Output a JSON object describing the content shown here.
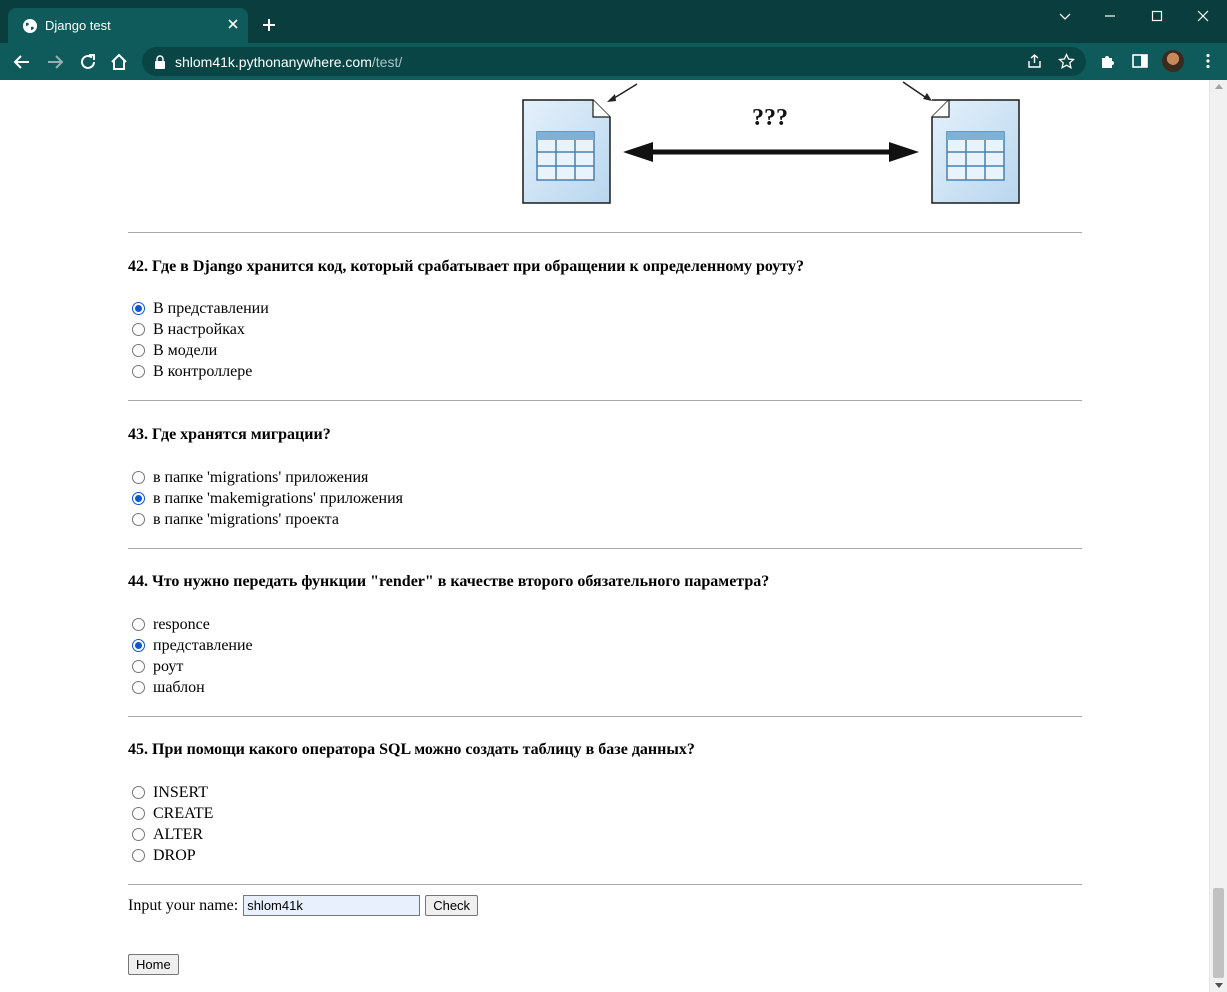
{
  "browser": {
    "tab_title": "Django test",
    "url_host": "shlom41k.pythonanywhere.com",
    "url_path": "/test/",
    "icons": [
      "globe-icon",
      "close-icon",
      "plus-icon",
      "chevron-down-icon",
      "minimize-icon",
      "maximize-icon",
      "close-window-icon",
      "back-icon",
      "forward-icon",
      "reload-icon",
      "home-icon",
      "lock-icon",
      "share-icon",
      "star-icon",
      "extensions-icon",
      "side-panel-icon",
      "avatar",
      "menu-icon"
    ]
  },
  "diagram": {
    "label": "???"
  },
  "questions": [
    {
      "title": "42. Где в Django хранится код, который срабатывает при обращении к определенному роуту?",
      "options": [
        {
          "label": "В представлении",
          "checked": true
        },
        {
          "label": "В настройках",
          "checked": false
        },
        {
          "label": "В модели",
          "checked": false
        },
        {
          "label": "В контроллере",
          "checked": false
        }
      ]
    },
    {
      "title": "43. Где хранятся миграции?",
      "options": [
        {
          "label": "в папке 'migrations' приложения",
          "checked": false
        },
        {
          "label": "в папке 'makemigrations' приложения",
          "checked": true
        },
        {
          "label": "в папке 'migrations' проекта",
          "checked": false
        }
      ]
    },
    {
      "title": "44. Что нужно передать функции \"render\" в качестве второго обязательного параметра?",
      "options": [
        {
          "label": "responce",
          "checked": false
        },
        {
          "label": "представление",
          "checked": true
        },
        {
          "label": "роут",
          "checked": false
        },
        {
          "label": "шаблон",
          "checked": false
        }
      ]
    },
    {
      "title": "45. При помощи какого оператора SQL можно создать таблицу в базе данных?",
      "options": [
        {
          "label": "INSERT",
          "checked": false
        },
        {
          "label": "CREATE",
          "checked": false
        },
        {
          "label": "ALTER",
          "checked": false
        },
        {
          "label": "DROP",
          "checked": false
        }
      ]
    }
  ],
  "form": {
    "name_label": "Input your name:",
    "name_value": "shlom41k",
    "check_label": "Check",
    "home_label": "Home"
  },
  "colors": {
    "tab_strip": "#0a3d3d",
    "toolbar": "#0f5a5a",
    "radio_checked": "#0b57d0",
    "autofill_bg": "#e8f0fe"
  }
}
